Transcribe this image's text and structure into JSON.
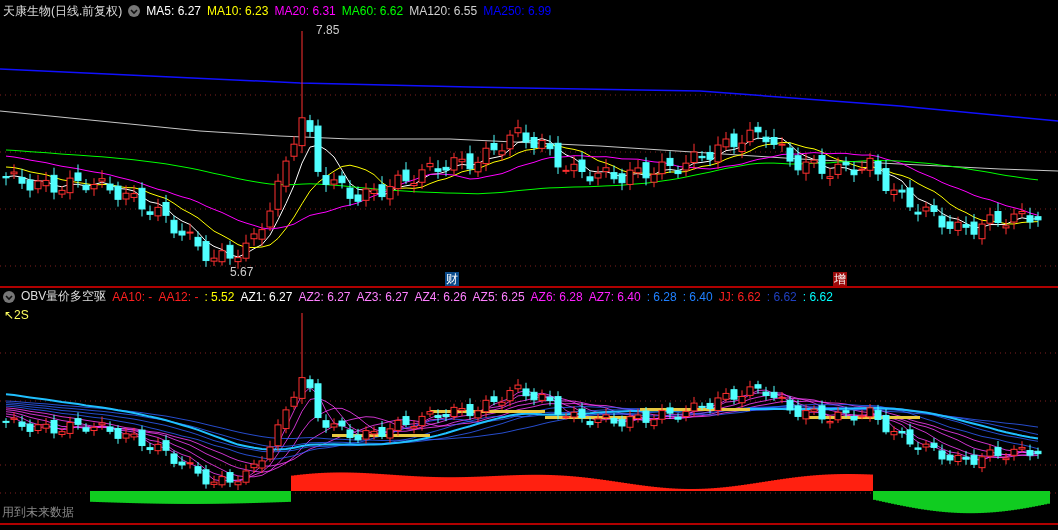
{
  "main_chart": {
    "title": "天康生物(日线.前复权)",
    "indicators": [
      {
        "text": "MA5: 6.27",
        "color": "#ffffff"
      },
      {
        "text": "MA10: 6.23",
        "color": "#ffff00"
      },
      {
        "text": "MA20: 6.31",
        "color": "#ff00ff"
      },
      {
        "text": "MA60: 6.62",
        "color": "#00ff00"
      },
      {
        "text": "MA120: 6.55",
        "color": "#d0d0d0"
      },
      {
        "text": "MA250: 6.99",
        "color": "#0000ff"
      }
    ],
    "high_label": "7.85",
    "low_label": "5.67",
    "event_markers": [
      {
        "text": "财",
        "color": "#0a4a8a"
      },
      {
        "text": "增",
        "color": "#9a0a0a"
      }
    ]
  },
  "indicator_panel": {
    "title": "OBV量价多空驱",
    "indicators": [
      {
        "text": "AA10: -",
        "color": "#ff2020"
      },
      {
        "text": "AA12: -",
        "color": "#ff2020"
      },
      {
        "text": ": 5.52",
        "color": "#ffff00"
      },
      {
        "text": "AZ1: 6.27",
        "color": "#ffffff"
      },
      {
        "text": "AZ2: 6.27",
        "color": "#ff80ff"
      },
      {
        "text": "AZ3: 6.27",
        "color": "#ff80ff"
      },
      {
        "text": "AZ4: 6.26",
        "color": "#ff80ff"
      },
      {
        "text": "AZ5: 6.25",
        "color": "#ff80ff"
      },
      {
        "text": "AZ6: 6.28",
        "color": "#ff20ff"
      },
      {
        "text": "AZ7: 6.40",
        "color": "#ff20ff"
      },
      {
        "text": ": 6.28",
        "color": "#2080ff"
      },
      {
        "text": ": 6.40",
        "color": "#2080ff"
      },
      {
        "text": "JJ: 6.62",
        "color": "#ff2020"
      },
      {
        "text": ": 6.62",
        "color": "#2040c0"
      },
      {
        "text": ": 6.62",
        "color": "#00ffff"
      }
    ],
    "corner_label": "↖2S",
    "footer_label": "用到未来数据"
  }
}
